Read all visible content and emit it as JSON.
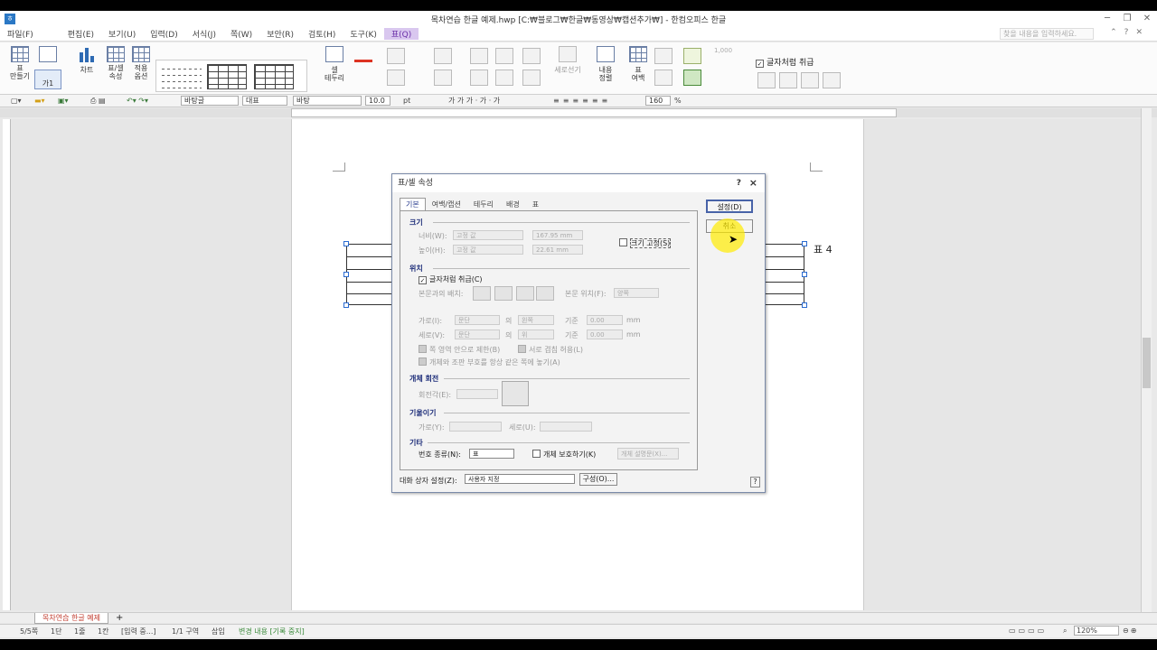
{
  "window": {
    "title": "목차연습 한글 예제.hwp [C:₩블로그₩한글₩동영상₩캡션추가₩] - 한컴오피스 한글",
    "app_icon": "hwp-icon"
  },
  "menu": {
    "items": [
      "파일(F)",
      "편집(E)",
      "보기(U)",
      "입력(D)",
      "서식(J)",
      "쪽(W)",
      "보안(R)",
      "검토(H)",
      "도구(K)",
      "표(Q)"
    ],
    "search_placeholder": "찾을 내용을 입력하세요."
  },
  "ribbon": {
    "make_table": "표\n만들기",
    "cell_label": "가1",
    "chart": "차트",
    "table_props": "표/셀\n속성",
    "apply_options": "적용\n옵션",
    "cell_border": "셀\n테두리",
    "divide": "세로선기",
    "content_align": "내용\n정렬",
    "table_margin": "표\n여백",
    "num": "1,000",
    "treat_as_char": "글자처럼 취급"
  },
  "toolbar": {
    "style": "바탕글",
    "lang": "대표",
    "font": "바탕",
    "size": "10.0",
    "unit": "pt",
    "format_labels": "가 가 가 · 가 · 가",
    "zoom_line": "160",
    "zoom_unit": "%"
  },
  "document": {
    "caption": "표 4"
  },
  "dialog": {
    "title": "표/셀 속성",
    "help": "?",
    "close": "×",
    "tabs": [
      "기본",
      "여백/캡션",
      "테두리",
      "배경",
      "표"
    ],
    "size": {
      "heading": "크기",
      "width_label": "너비(W):",
      "width_mode": "고정 값",
      "width_value": "167.95 mm",
      "height_label": "높이(H):",
      "height_mode": "고정 값",
      "height_value": "22.61 mm",
      "fix_ratio": "크기 고정(S)"
    },
    "position": {
      "heading": "위치",
      "treat_as_char": "글자처럼 취급(C)",
      "wrap_label": "본문과의 배치:",
      "body_pos_label": "본문 위치(F):",
      "body_pos_value": "양쪽",
      "horiz_label": "가로(I):",
      "horiz_ref": "문단",
      "of1": "의",
      "horiz_align": "왼쪽",
      "base1": "기준",
      "horiz_value": "0.00",
      "unit1": "mm",
      "vert_label": "세로(V):",
      "vert_ref": "문단",
      "of2": "의",
      "vert_align": "위",
      "base2": "기준",
      "vert_value": "0.00",
      "unit2": "mm",
      "limit_page": "쪽 영역 안으로 제한(B)",
      "allow_overlap": "서로 겹침 허용(L)",
      "keep_anchor": "개체와 조판 부호를 항상 같은 쪽에 놓기(A)"
    },
    "rotation": {
      "heading": "개체 회전",
      "angle_label": "회전각(E):"
    },
    "skew": {
      "heading": "기울이기",
      "horiz_label": "가로(Y):",
      "vert_label": "세로(U):"
    },
    "etc": {
      "heading": "기타",
      "num_type_label": "번호 종류(N):",
      "num_type_value": "표",
      "protect": "개체 보호하기(K)",
      "desc_button": "개체 설명문(X)..."
    },
    "set_button": "설정(D)",
    "cancel_button": "취소",
    "preset_label": "대화 상자 설정(Z):",
    "preset_value": "사용자 지정",
    "compose_button": "구성(O)..."
  },
  "sheet_tab": "목차연습 한글 예제",
  "status": {
    "page": "5/5쪽",
    "column": "1단",
    "line": "1줄",
    "char": "1칸",
    "mode": "[입력 중...]",
    "section": "1/1 구역",
    "insert": "삽입",
    "track": "변경 내용 [기록 중지]",
    "zoom": "120%"
  }
}
